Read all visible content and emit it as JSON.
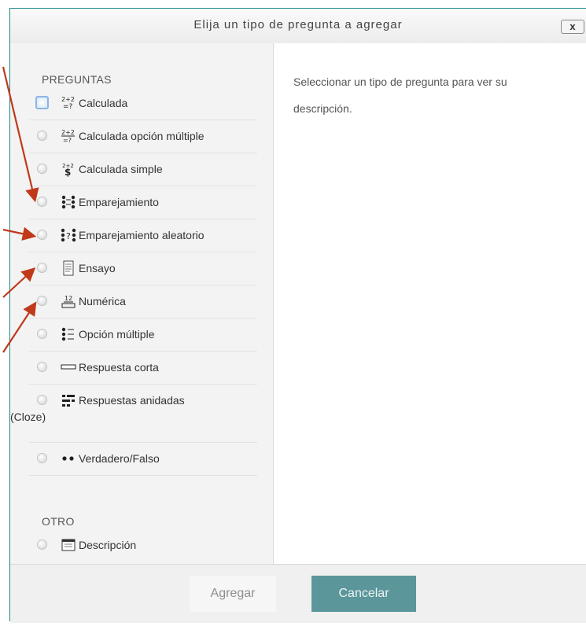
{
  "dialog": {
    "title": "Elija un tipo de pregunta a agregar",
    "close_label": "x"
  },
  "sections": {
    "preguntas": "PREGUNTAS",
    "otro": "OTRO"
  },
  "options": [
    {
      "label": "Calculada",
      "icon": "calculated-icon",
      "focused": true
    },
    {
      "label": "Calculada opción múltiple",
      "icon": "calculated-multichoice-icon"
    },
    {
      "label": "Calculada simple",
      "icon": "calculated-simple-icon"
    },
    {
      "label": "Emparejamiento",
      "icon": "matching-icon"
    },
    {
      "label": "Emparejamiento aleatorio",
      "icon": "random-matching-icon"
    },
    {
      "label": "Ensayo",
      "icon": "essay-icon"
    },
    {
      "label": "Numérica",
      "icon": "numerical-icon"
    },
    {
      "label": "Opción múltiple",
      "icon": "multichoice-icon"
    },
    {
      "label": "Respuesta corta",
      "icon": "short-answer-icon"
    },
    {
      "label": "Respuestas anidadas",
      "label_cont": "(Cloze)",
      "icon": "cloze-icon"
    },
    {
      "label": "Verdadero/Falso",
      "icon": "true-false-icon"
    }
  ],
  "other_options": [
    {
      "label": "Descripción",
      "icon": "description-icon"
    }
  ],
  "description_panel": {
    "text": "Seleccionar un tipo de pregunta para ver su descripción."
  },
  "footer": {
    "add_label": "Agregar",
    "cancel_label": "Cancelar"
  },
  "colors": {
    "accent": "#5b969a",
    "border": "#1f8a87",
    "annotation_arrow": "#c0391b"
  }
}
